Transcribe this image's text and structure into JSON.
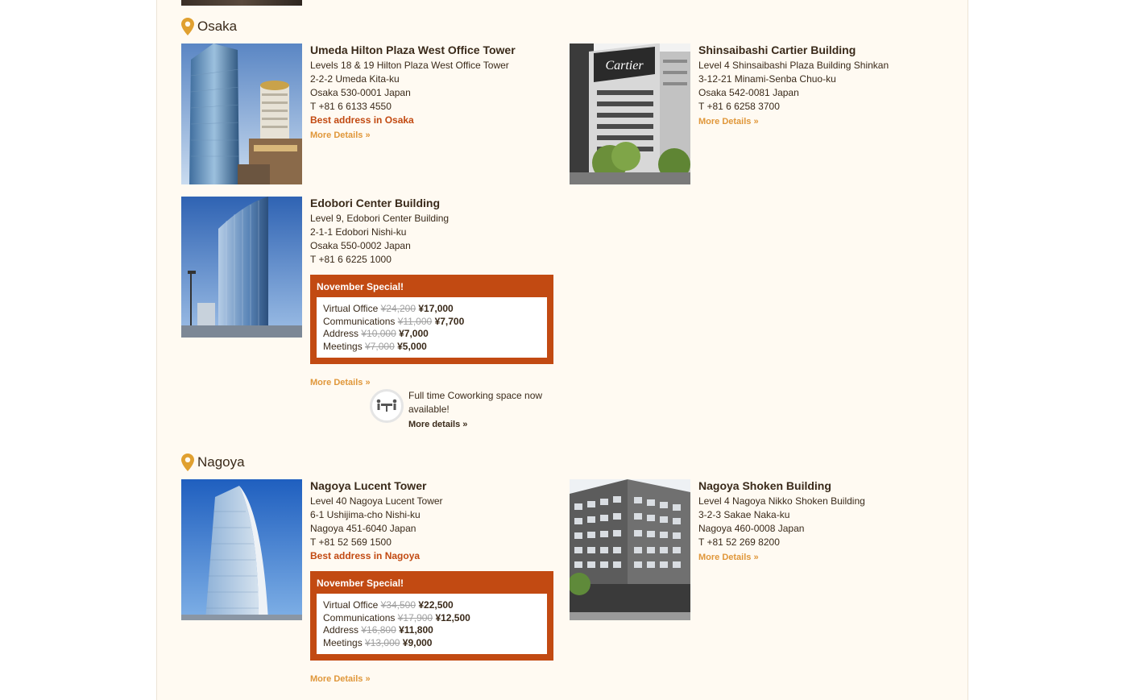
{
  "colors": {
    "accent": "#c24a12",
    "link": "#e0973a",
    "pin": "#e0a030",
    "page_bg": "#fffaf2"
  },
  "sections": [
    {
      "city": "Osaka"
    },
    {
      "city": "Nagoya"
    }
  ],
  "osaka": {
    "umeda": {
      "name": "Umeda Hilton Plaza West Office Tower",
      "lines": [
        "Levels 18 & 19 Hilton Plaza West Office Tower",
        "2-2-2 Umeda Kita-ku",
        "Osaka 530-0001 Japan",
        "T +81 6 6133 4550"
      ],
      "best": "Best address in Osaka",
      "more": "More Details »"
    },
    "shinsaibashi": {
      "name": "Shinsaibashi Cartier Building",
      "lines": [
        "Level 4 Shinsaibashi Plaza Building Shinkan",
        "3-12-21 Minami-Senba Chuo-ku",
        "Osaka 542-0081 Japan",
        "T +81 6 6258 3700"
      ],
      "more": "More Details »",
      "sign": "Cartier"
    },
    "edobori": {
      "name": "Edobori Center Building",
      "lines": [
        "Level 9, Edobori Center Building",
        "2-1-1 Edobori Nishi-ku",
        "Osaka 550-0002 Japan",
        "T +81 6 6225 1000"
      ],
      "special": {
        "title": "November Special!",
        "rows": [
          {
            "label": "Virtual Office",
            "old": "¥24,200",
            "new": "¥17,000"
          },
          {
            "label": "Communications",
            "old": "¥11,000",
            "new": "¥7,700"
          },
          {
            "label": "Address",
            "old": "¥10,000",
            "new": "¥7,000"
          },
          {
            "label": "Meetings",
            "old": "¥7,000",
            "new": "¥5,000"
          }
        ]
      },
      "more": "More Details »",
      "cowork": {
        "text": "Full time Coworking space now available!",
        "more": "More details »"
      }
    }
  },
  "nagoya": {
    "lucent": {
      "name": "Nagoya Lucent Tower",
      "lines": [
        "Level 40 Nagoya Lucent Tower",
        "6-1 Ushijima-cho Nishi-ku",
        "Nagoya 451-6040 Japan",
        "T +81 52 569 1500"
      ],
      "best": "Best address in Nagoya",
      "special": {
        "title": "November Special!",
        "rows": [
          {
            "label": "Virtual Office",
            "old": "¥34,500",
            "new": "¥22,500"
          },
          {
            "label": "Communications",
            "old": "¥17,900",
            "new": "¥12,500"
          },
          {
            "label": "Address",
            "old": "¥16,800",
            "new": "¥11,800"
          },
          {
            "label": "Meetings",
            "old": "¥13,000",
            "new": "¥9,000"
          }
        ]
      },
      "more": "More Details »"
    },
    "shoken": {
      "name": "Nagoya Shoken Building",
      "lines": [
        "Level 4 Nagoya Nikko Shoken Building",
        "3-2-3 Sakae Naka-ku",
        "Nagoya 460-0008 Japan",
        "T +81 52 269 8200"
      ],
      "more": "More Details »"
    }
  }
}
